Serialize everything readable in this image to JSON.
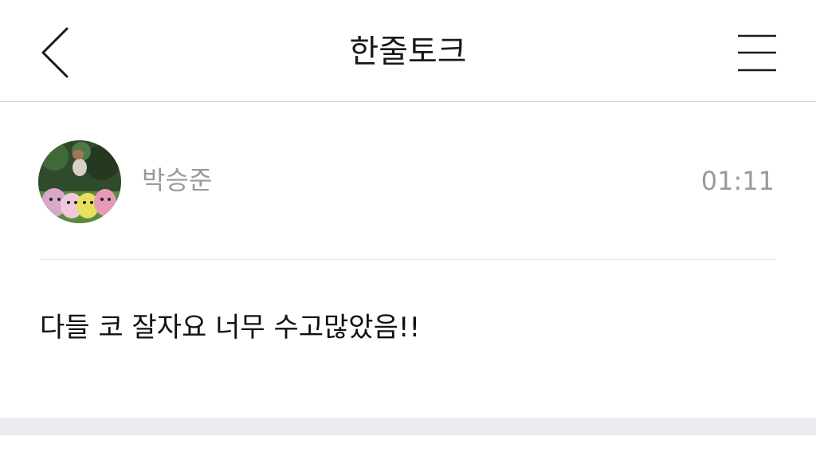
{
  "header": {
    "title": "한줄토크",
    "back_icon": "chevron-left-icon",
    "menu_icon": "hamburger-menu-icon"
  },
  "post": {
    "author": "박승준",
    "time": "01:11",
    "message": "다들 코 잘자요 너무 수고많았음!!"
  },
  "colors": {
    "background": "#ffffff",
    "text_primary": "#1a1a1a",
    "text_secondary": "#9a9a9a",
    "divider": "#e3e3e3",
    "footer_band": "#ebebef"
  }
}
